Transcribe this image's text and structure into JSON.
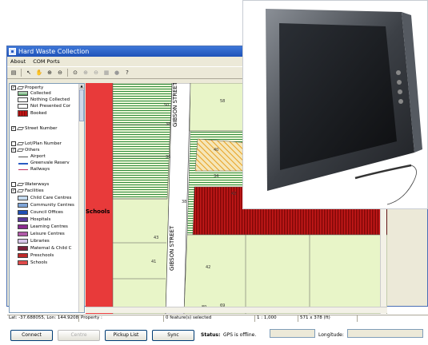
{
  "window": {
    "title": "Hard Waste Collection"
  },
  "menu": {
    "items": [
      "About",
      "COM Ports"
    ]
  },
  "toolbar": {
    "icons": [
      "layers-icon",
      "select-arrow-icon",
      "pan-hand-icon",
      "zoom-in-icon",
      "zoom-out-icon",
      "zoom-extent-icon",
      "zoom-prev-icon",
      "zoom-next-icon",
      "measure-icon",
      "gps-icon",
      "info-icon"
    ]
  },
  "legend": {
    "groups": [
      {
        "label": "Property",
        "checked": true
      },
      {
        "label": "Street Number",
        "checked": true
      },
      {
        "label": "Lot/Plan Number",
        "checked": false
      },
      {
        "label": "Others",
        "checked": true
      },
      {
        "label": "Waterways",
        "checked": false
      },
      {
        "label": "Facilities",
        "checked": true
      }
    ],
    "property_items": [
      "Collected",
      "Nothing Collected",
      "Not Presented Cor",
      "Booked"
    ],
    "others_items": [
      "Airport",
      "Greenvale Reserv",
      "Railways"
    ],
    "facility_items": [
      "Child Care Centres",
      "Community Centres",
      "Council Offices",
      "Hospitals",
      "Learning Centres",
      "Leisure Centres",
      "Libraries",
      "Maternal & Child C",
      "Preschools",
      "Schools"
    ],
    "facility_colors": [
      "#c7dcf0",
      "#7fa5d8",
      "#1f4fb5",
      "#5a3a9a",
      "#8a2a8f",
      "#b05aa8",
      "#d7c4e8",
      "#7a1f3a",
      "#c02a2a",
      "#e04a4a"
    ]
  },
  "map": {
    "street_labels": [
      "GIBSON STREET",
      "GIBSON STREET"
    ],
    "place_label": "Schools",
    "lot_numbers": [
      "50",
      "58",
      "38",
      "40",
      "36",
      "34",
      "42",
      "38",
      "43",
      "41",
      "42",
      "89",
      "69"
    ],
    "colors": {
      "collected": "#2e8b3a",
      "booked": "#e02020",
      "parcel": "#e8f5c8",
      "school": "#e83a3a",
      "not_presented": "#e8a020"
    }
  },
  "status": {
    "coords": "Lat: -37.688055, Lon: 144.920882",
    "layer": "Property :",
    "selected": "0 feature(s) selected",
    "scale": "1 : 1,000",
    "extent": "571 x 378 (ft)"
  },
  "bottom": {
    "connect": "Connect",
    "centre": "Centre",
    "pickup": "Pickup List",
    "sync": "Sync",
    "status_label": "Status:",
    "status_value": "GPS is offline.",
    "longitude_label": "Longitude:"
  }
}
